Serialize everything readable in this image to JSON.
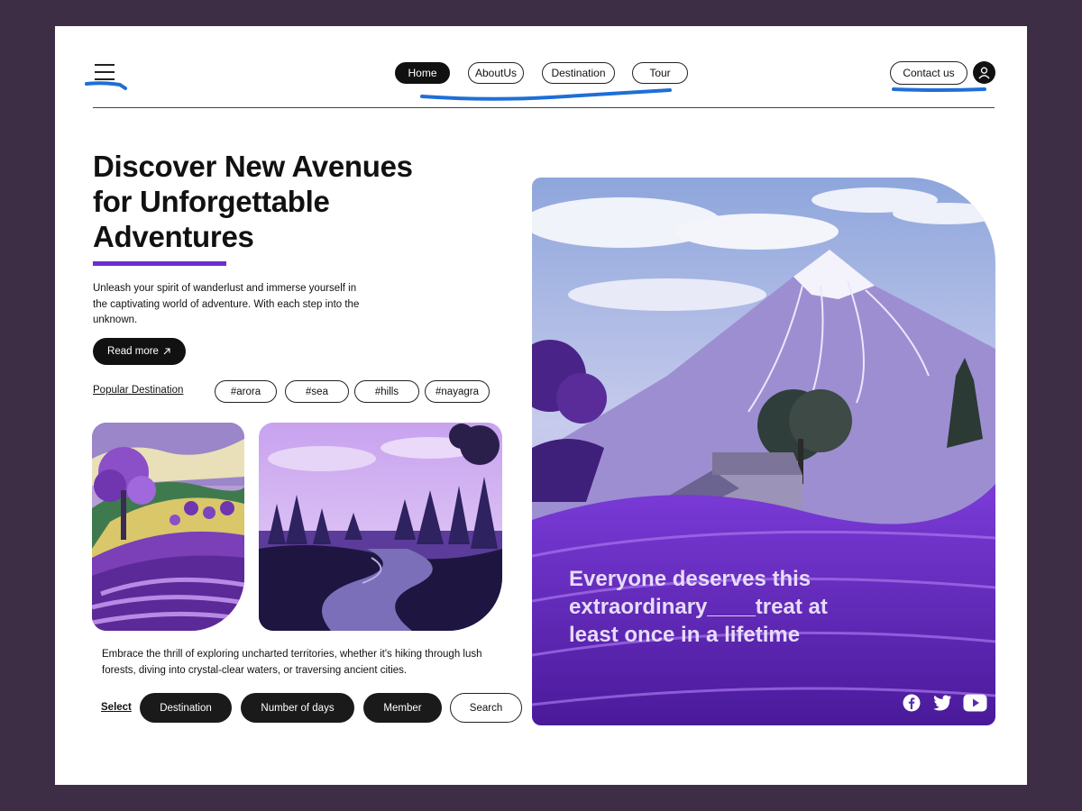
{
  "nav": {
    "links": [
      "Home",
      "AboutUs",
      "Destination",
      "Tour"
    ],
    "active": "Home",
    "contact_label": "Contact us"
  },
  "hero": {
    "title_line1": "Discover New Avenues",
    "title_line2": "for Unforgettable",
    "title_line3": "Adventures",
    "description": "Unleash your spirit of wanderlust and immerse yourself in the captivating world of adventure. With each step into the unknown.",
    "read_more_label": "Read more",
    "read_more_icon": "arrow-up-right-icon"
  },
  "popular": {
    "label": "Popular Destination",
    "tags": [
      "#arora",
      "#sea",
      "#hills",
      "#nayagra"
    ]
  },
  "embrace_text": "Embrace the thrill of exploring uncharted territories, whether it's hiking through lush forests, diving into crystal-clear waters, or traversing ancient cities.",
  "filters": {
    "select_label": "Select",
    "options": [
      "Destination",
      "Number of days",
      "Member"
    ],
    "search_label": "Search"
  },
  "feature": {
    "quote": "Everyone deserves this extraordinary____treat at least once in a lifetime",
    "social_icons": [
      "facebook-icon",
      "twitter-icon",
      "youtube-icon"
    ]
  },
  "colors": {
    "frame_background": "#3d2e45",
    "accent_purple": "#6a2fd0",
    "annotation_blue": "#1e6fd6",
    "dark_pill": "#111111"
  }
}
